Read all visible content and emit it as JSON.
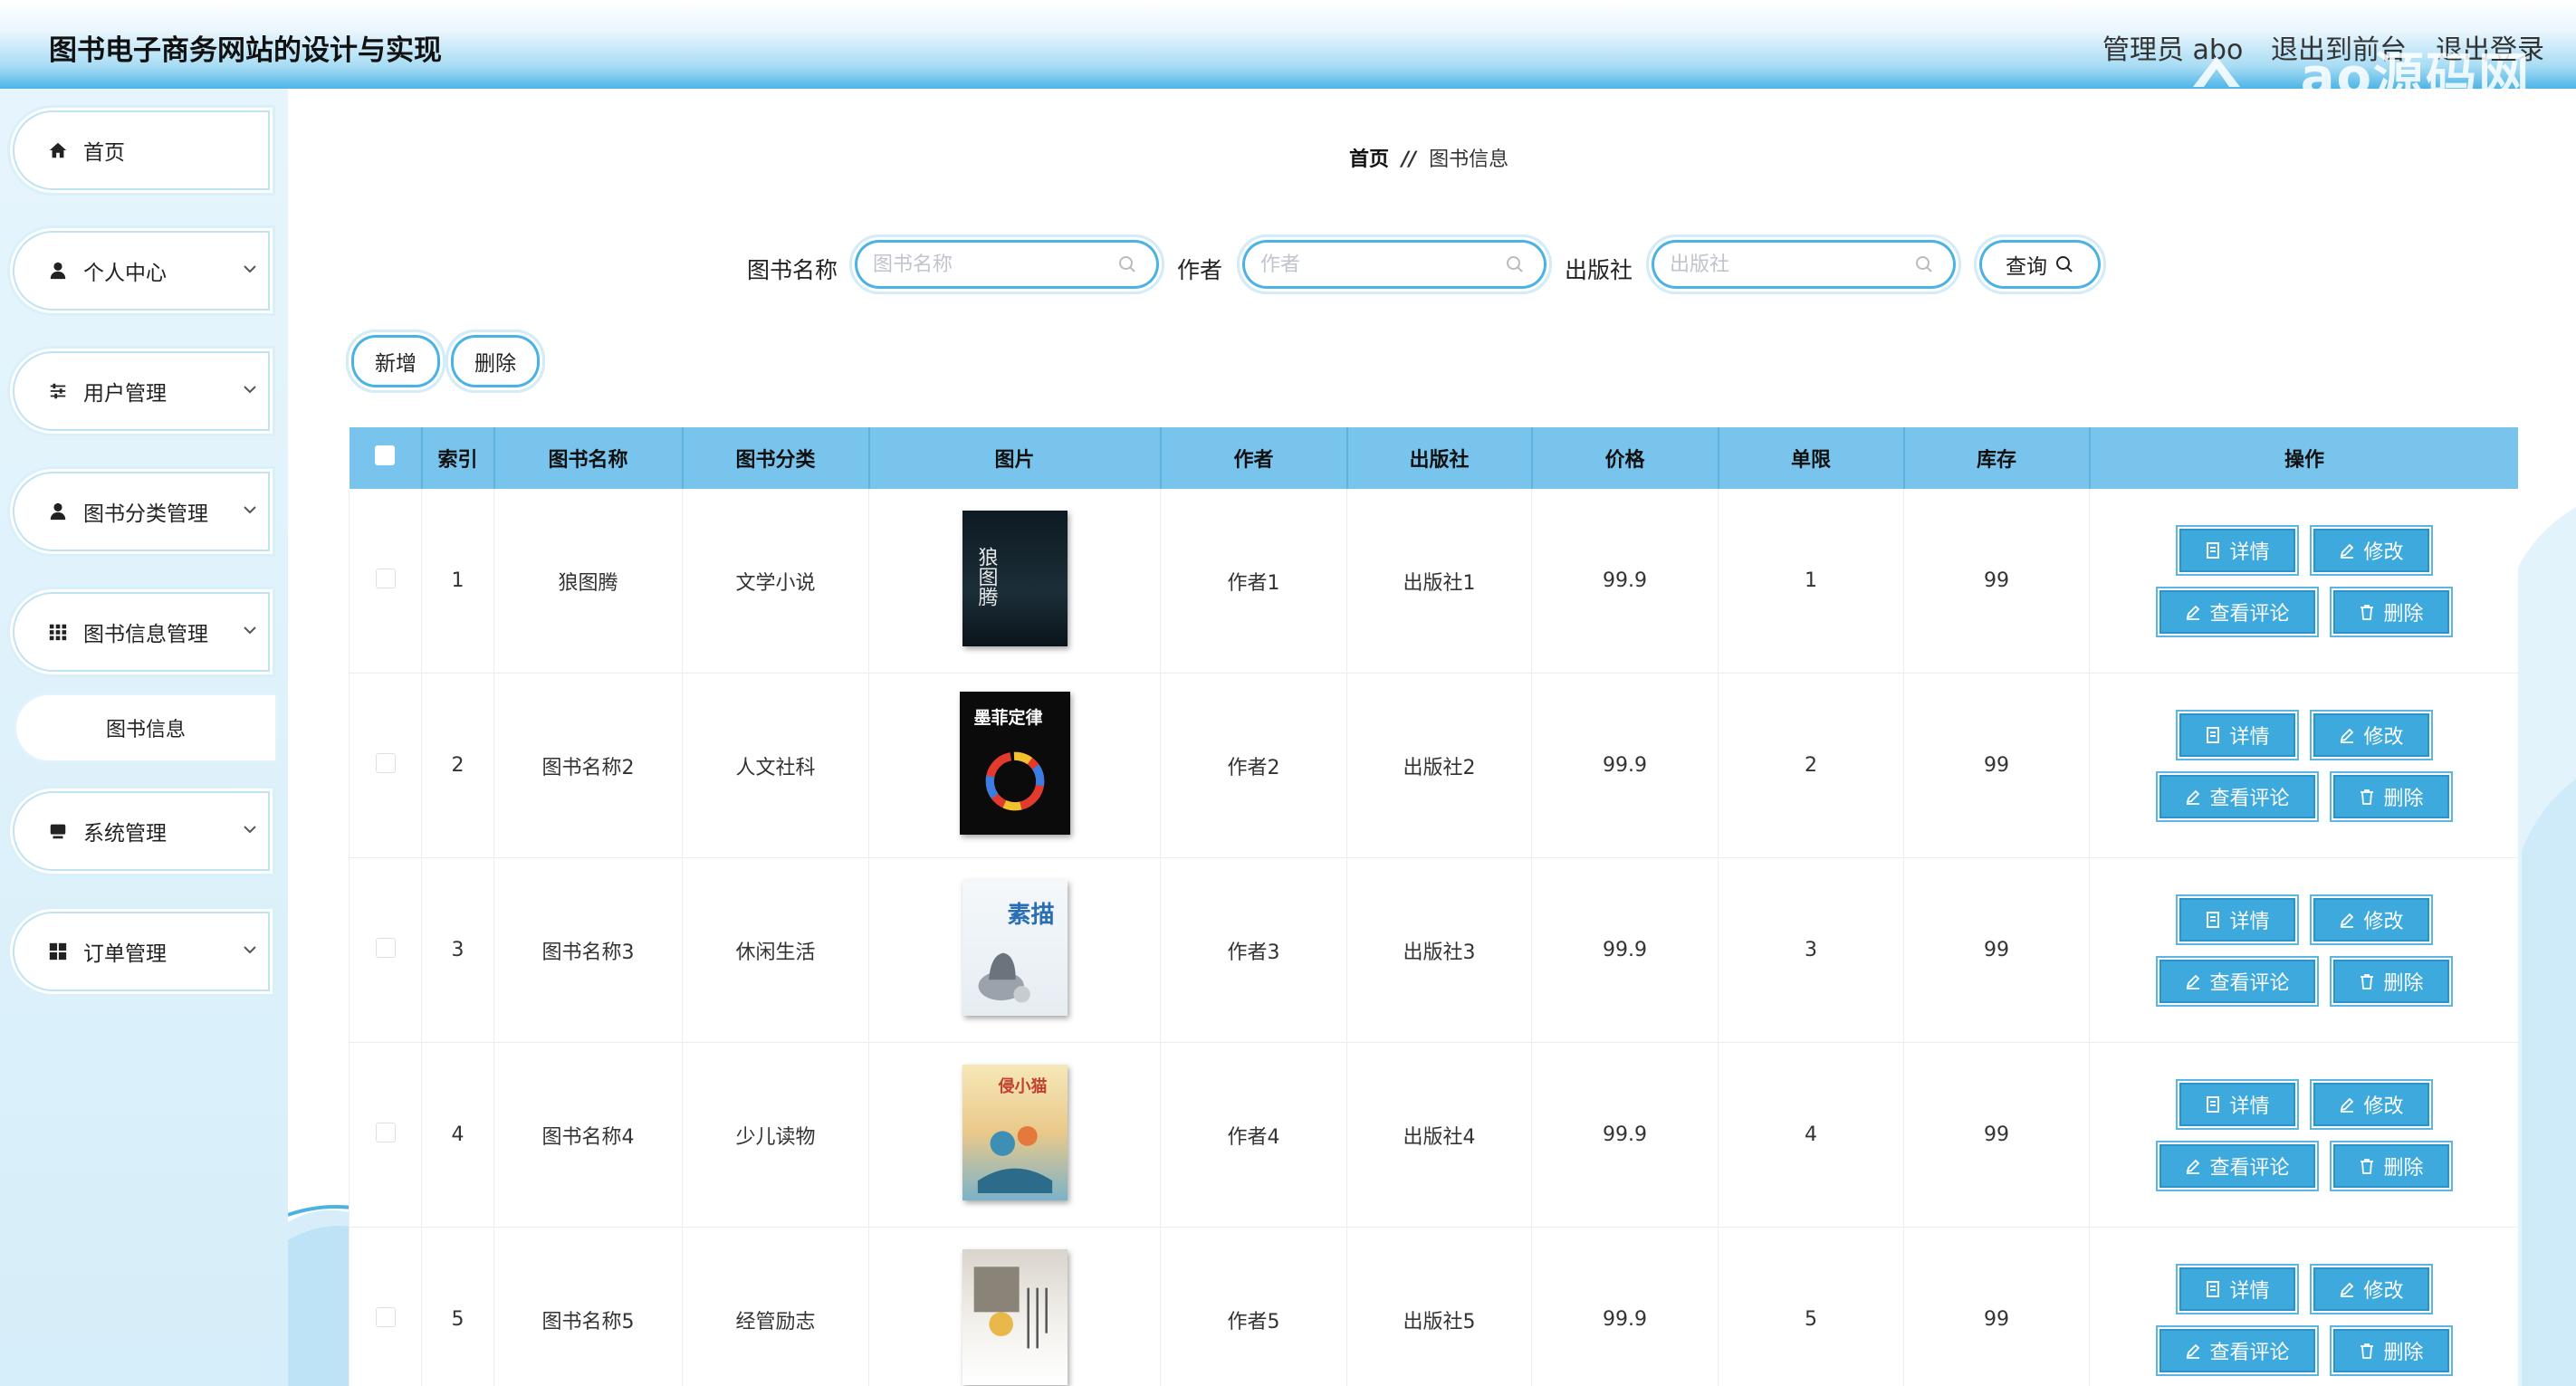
{
  "header": {
    "title": "图书电子商务网站的设计与实现",
    "user": "管理员 abo",
    "to_front": "退出到前台",
    "logout": "退出登录",
    "watermark": "ao源码网"
  },
  "sidebar": {
    "items": [
      {
        "label": "首页",
        "icon": "home-icon"
      },
      {
        "label": "个人中心",
        "icon": "user-icon"
      },
      {
        "label": "用户管理",
        "icon": "sliders-icon"
      },
      {
        "label": "图书分类管理",
        "icon": "user-icon"
      },
      {
        "label": "图书信息管理",
        "icon": "grid-icon"
      },
      {
        "label": "系统管理",
        "icon": "monitor-icon"
      },
      {
        "label": "订单管理",
        "icon": "apps-icon"
      }
    ],
    "sub_item": "图书信息"
  },
  "breadcrumb": {
    "home": "首页",
    "sep": "//",
    "current": "图书信息"
  },
  "search": {
    "name_label": "图书名称",
    "name_placeholder": "图书名称",
    "author_label": "作者",
    "author_placeholder": "作者",
    "publisher_label": "出版社",
    "publisher_placeholder": "出版社",
    "query_button": "查询"
  },
  "toolbar": {
    "add": "新增",
    "delete": "删除"
  },
  "table": {
    "headers": [
      "索引",
      "图书名称",
      "图书分类",
      "图片",
      "作者",
      "出版社",
      "价格",
      "单限",
      "库存",
      "操作"
    ],
    "rows": [
      {
        "index": "1",
        "name": "狼图腾",
        "category": "文学小说",
        "author": "作者1",
        "publisher": "出版社1",
        "price": "99.9",
        "limit": "1",
        "stock": "99",
        "cover_text": "狼图腾"
      },
      {
        "index": "2",
        "name": "图书名称2",
        "category": "人文社科",
        "author": "作者2",
        "publisher": "出版社2",
        "price": "99.9",
        "limit": "2",
        "stock": "99",
        "cover_text": "墨菲定律"
      },
      {
        "index": "3",
        "name": "图书名称3",
        "category": "休闲生活",
        "author": "作者3",
        "publisher": "出版社3",
        "price": "99.9",
        "limit": "3",
        "stock": "99",
        "cover_text": "素描"
      },
      {
        "index": "4",
        "name": "图书名称4",
        "category": "少儿读物",
        "author": "作者4",
        "publisher": "出版社4",
        "price": "99.9",
        "limit": "4",
        "stock": "99",
        "cover_text": "侵小猫"
      },
      {
        "index": "5",
        "name": "图书名称5",
        "category": "经管励志",
        "author": "作者5",
        "publisher": "出版社5",
        "price": "99.9",
        "limit": "5",
        "stock": "99",
        "cover_text": ""
      }
    ],
    "actions": {
      "detail": "详情",
      "edit": "修改",
      "comments": "查看评论",
      "delete": "删除"
    }
  }
}
